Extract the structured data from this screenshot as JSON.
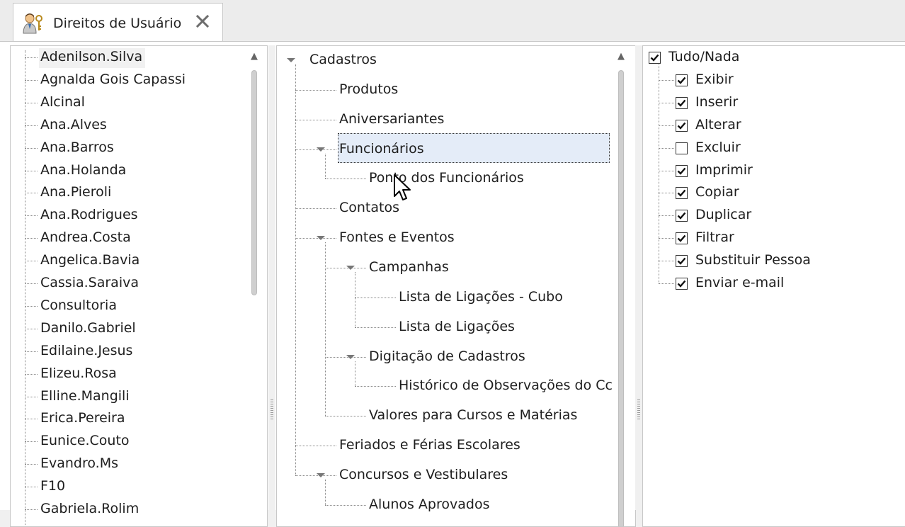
{
  "tab": {
    "title": "Direitos de Usuário",
    "close_glyph": "✕",
    "icon": "users-key-icon"
  },
  "users": [
    "Adenilson.Silva",
    "Agnalda Gois Capassi",
    "Alcinal",
    "Ana.Alves",
    "Ana.Barros",
    "Ana.Holanda",
    "Ana.Pieroli",
    "Ana.Rodrigues",
    "Andrea.Costa",
    "Angelica.Bavia",
    "Cassia.Saraiva",
    "Consultoria",
    "Danilo.Gabriel",
    "Edilaine.Jesus",
    "Elizeu.Rosa",
    "Elline.Mangili",
    "Erica.Pereira",
    "Eunice.Couto",
    "Evandro.Ms",
    "F10",
    "Gabriela.Rolim"
  ],
  "selected_user": "Adenilson.Silva",
  "modules": [
    {
      "label": "Cadastros",
      "level": 0,
      "expanded": true
    },
    {
      "label": "Produtos",
      "level": 1
    },
    {
      "label": "Aniversariantes",
      "level": 1
    },
    {
      "label": "Funcionários",
      "level": 1,
      "expanded": true,
      "selected": true
    },
    {
      "label": "Ponto dos Funcionários",
      "level": 2
    },
    {
      "label": "Contatos",
      "level": 1
    },
    {
      "label": "Fontes e Eventos",
      "level": 1,
      "expanded": true
    },
    {
      "label": "Campanhas",
      "level": 2,
      "expanded": true
    },
    {
      "label": "Lista de Ligações - Cubo",
      "level": 3
    },
    {
      "label": "Lista de Ligações",
      "level": 3
    },
    {
      "label": "Digitação de Cadastros",
      "level": 2,
      "expanded": true
    },
    {
      "label": "Histórico de Observações do Cc",
      "level": 3
    },
    {
      "label": "Valores para Cursos e Matérias",
      "level": 2
    },
    {
      "label": "Feriados e Férias Escolares",
      "level": 1
    },
    {
      "label": "Concursos e Vestibulares",
      "level": 1,
      "expanded": true
    },
    {
      "label": "Alunos Aprovados",
      "level": 2
    }
  ],
  "permissions": {
    "all": {
      "label": "Tudo/Nada",
      "checked": true
    },
    "items": [
      {
        "label": "Exibir",
        "checked": true
      },
      {
        "label": "Inserir",
        "checked": true
      },
      {
        "label": "Alterar",
        "checked": true
      },
      {
        "label": "Excluir",
        "checked": false
      },
      {
        "label": "Imprimir",
        "checked": true
      },
      {
        "label": "Copiar",
        "checked": true
      },
      {
        "label": "Duplicar",
        "checked": true
      },
      {
        "label": "Filtrar",
        "checked": true
      },
      {
        "label": "Substituir Pessoa",
        "checked": true
      },
      {
        "label": "Enviar e-mail",
        "checked": true
      }
    ]
  },
  "colors": {
    "selection": "#e4ecf8",
    "border": "#c8c8c8",
    "text": "#1e1e1e"
  }
}
